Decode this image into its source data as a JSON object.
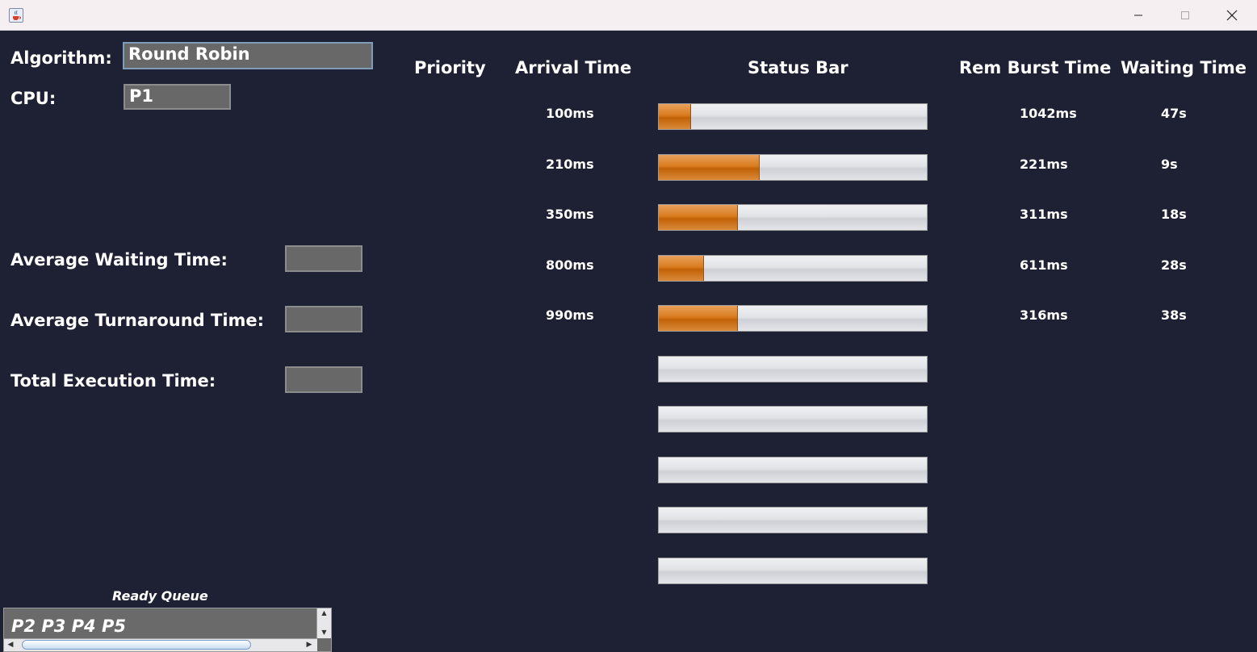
{
  "window": {
    "icon": "java-cup-icon",
    "controls": [
      "minimize-icon",
      "maximize-icon",
      "close-icon"
    ]
  },
  "left": {
    "algorithm_label": "Algorithm:",
    "algorithm_value": "Round Robin",
    "cpu_label": "CPU:",
    "cpu_value": "P1",
    "avg_waiting_label": "Average Waiting Time:",
    "avg_waiting_value": "",
    "avg_turnaround_label": "Average Turnaround Time:",
    "avg_turnaround_value": "",
    "total_exec_label": "Total Execution Time:",
    "total_exec_value": ""
  },
  "table": {
    "headers": {
      "priority": "Priority",
      "arrival": "Arrival Time",
      "status": "Status Bar",
      "rem_burst": "Rem Burst Time",
      "waiting": "Waiting Time"
    },
    "rows": [
      {
        "arrival": "100ms",
        "progress": 0.12,
        "rem_burst": "1042ms",
        "waiting": "47s"
      },
      {
        "arrival": "210ms",
        "progress": 0.375,
        "rem_burst": "221ms",
        "waiting": "9s"
      },
      {
        "arrival": "350ms",
        "progress": 0.295,
        "rem_burst": "311ms",
        "waiting": "18s"
      },
      {
        "arrival": "800ms",
        "progress": 0.17,
        "rem_burst": "611ms",
        "waiting": "28s"
      },
      {
        "arrival": "990ms",
        "progress": 0.295,
        "rem_burst": "316ms",
        "waiting": "38s"
      },
      {
        "arrival": "",
        "progress": 0,
        "rem_burst": "",
        "waiting": ""
      },
      {
        "arrival": "",
        "progress": 0,
        "rem_burst": "",
        "waiting": ""
      },
      {
        "arrival": "",
        "progress": 0,
        "rem_burst": "",
        "waiting": ""
      },
      {
        "arrival": "",
        "progress": 0,
        "rem_burst": "",
        "waiting": ""
      },
      {
        "arrival": "",
        "progress": 0,
        "rem_burst": "",
        "waiting": ""
      }
    ]
  },
  "ready_queue": {
    "label": "Ready Queue",
    "value": "P2 P3 P4 P5"
  },
  "colors": {
    "background": "#1e2133",
    "field": "#686868",
    "progress": "#d97b1e"
  }
}
